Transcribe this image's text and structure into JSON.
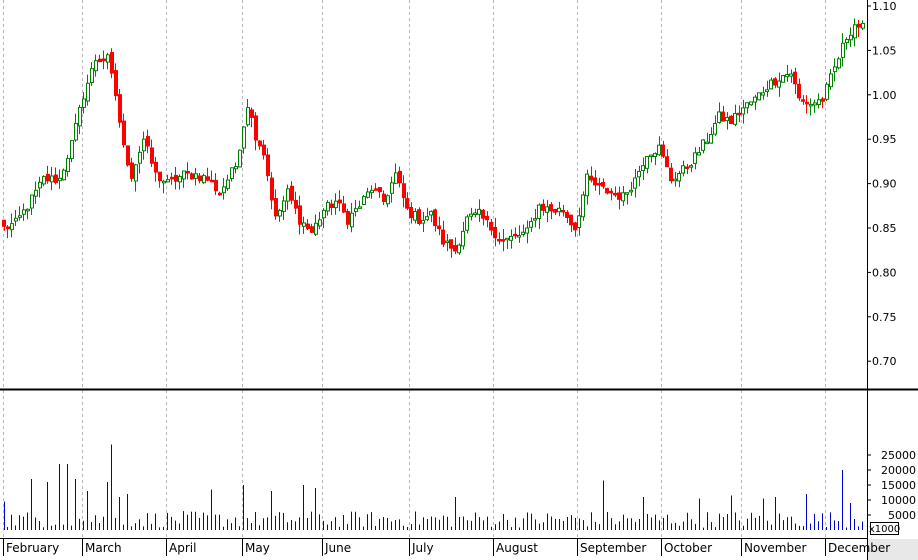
{
  "chart_data": [
    {
      "type": "candlestick",
      "panel": "price",
      "ylim": [
        0.66,
        1.1
      ],
      "y_ticks": [
        "1.10",
        "1.05",
        "1.00",
        "0.95",
        "0.90",
        "0.85",
        "0.80",
        "0.75",
        "0.70"
      ],
      "grid": "vertical-dashed-at-months",
      "colors": {
        "up": "#008000",
        "down": "#ff0000",
        "up_fill": "#ffffff",
        "down_fill": "#ff0000"
      },
      "anchors": [
        {
          "i": 0,
          "close": 0.85
        },
        {
          "i": 3,
          "close": 0.855
        },
        {
          "i": 6,
          "close": 0.875
        },
        {
          "i": 10,
          "close": 0.905
        },
        {
          "i": 14,
          "close": 0.905
        },
        {
          "i": 17,
          "close": 0.945
        },
        {
          "i": 20,
          "close": 1.0
        },
        {
          "i": 23,
          "close": 1.04
        },
        {
          "i": 26,
          "close": 1.04
        },
        {
          "i": 28,
          "close": 1.0
        },
        {
          "i": 30,
          "close": 0.94
        },
        {
          "i": 32,
          "close": 0.91
        },
        {
          "i": 35,
          "close": 0.95
        },
        {
          "i": 38,
          "close": 0.91
        },
        {
          "i": 41,
          "close": 0.9
        },
        {
          "i": 45,
          "close": 0.91
        },
        {
          "i": 48,
          "close": 0.91
        },
        {
          "i": 51,
          "close": 0.905
        },
        {
          "i": 54,
          "close": 0.89
        },
        {
          "i": 58,
          "close": 0.92
        },
        {
          "i": 61,
          "close": 0.99
        },
        {
          "i": 63,
          "close": 0.955
        },
        {
          "i": 65,
          "close": 0.935
        },
        {
          "i": 68,
          "close": 0.86
        },
        {
          "i": 71,
          "close": 0.89
        },
        {
          "i": 74,
          "close": 0.86
        },
        {
          "i": 77,
          "close": 0.845
        },
        {
          "i": 80,
          "close": 0.87
        },
        {
          "i": 83,
          "close": 0.88
        },
        {
          "i": 86,
          "close": 0.86
        },
        {
          "i": 89,
          "close": 0.875
        },
        {
          "i": 92,
          "close": 0.895
        },
        {
          "i": 95,
          "close": 0.88
        },
        {
          "i": 98,
          "close": 0.91
        },
        {
          "i": 101,
          "close": 0.87
        },
        {
          "i": 104,
          "close": 0.86
        },
        {
          "i": 107,
          "close": 0.865
        },
        {
          "i": 110,
          "close": 0.835
        },
        {
          "i": 113,
          "close": 0.825
        },
        {
          "i": 116,
          "close": 0.86
        },
        {
          "i": 119,
          "close": 0.865
        },
        {
          "i": 122,
          "close": 0.85
        },
        {
          "i": 125,
          "close": 0.835
        },
        {
          "i": 128,
          "close": 0.84
        },
        {
          "i": 131,
          "close": 0.845
        },
        {
          "i": 134,
          "close": 0.875
        },
        {
          "i": 137,
          "close": 0.87
        },
        {
          "i": 140,
          "close": 0.87
        },
        {
          "i": 143,
          "close": 0.85
        },
        {
          "i": 146,
          "close": 0.905
        },
        {
          "i": 149,
          "close": 0.895
        },
        {
          "i": 152,
          "close": 0.89
        },
        {
          "i": 155,
          "close": 0.885
        },
        {
          "i": 158,
          "close": 0.905
        },
        {
          "i": 161,
          "close": 0.935
        },
        {
          "i": 164,
          "close": 0.94
        },
        {
          "i": 167,
          "close": 0.905
        },
        {
          "i": 170,
          "close": 0.915
        },
        {
          "i": 173,
          "close": 0.93
        },
        {
          "i": 176,
          "close": 0.95
        },
        {
          "i": 179,
          "close": 0.975
        },
        {
          "i": 182,
          "close": 0.97
        },
        {
          "i": 185,
          "close": 0.985
        },
        {
          "i": 188,
          "close": 0.995
        },
        {
          "i": 191,
          "close": 1.01
        },
        {
          "i": 194,
          "close": 1.02
        },
        {
          "i": 197,
          "close": 1.025
        },
        {
          "i": 199,
          "close": 0.995
        },
        {
          "i": 202,
          "close": 0.99
        },
        {
          "i": 205,
          "close": 0.995
        },
        {
          "i": 208,
          "close": 1.03
        },
        {
          "i": 211,
          "close": 1.065
        },
        {
          "i": 213,
          "close": 1.08
        },
        {
          "i": 215,
          "close": 1.075
        }
      ]
    },
    {
      "type": "bar",
      "panel": "volume",
      "ylim": [
        0,
        30000
      ],
      "y_ticks": [
        "25000",
        "20000",
        "15000",
        "10000",
        "5000"
      ],
      "multiplier_label": "x1000",
      "color": "#0000cc",
      "spikes": [
        {
          "i": 0,
          "v": 9500
        },
        {
          "i": 7,
          "v": 17000
        },
        {
          "i": 11,
          "v": 16000
        },
        {
          "i": 14,
          "v": 22000
        },
        {
          "i": 16,
          "v": 22000
        },
        {
          "i": 18,
          "v": 17000
        },
        {
          "i": 21,
          "v": 13000
        },
        {
          "i": 26,
          "v": 16000
        },
        {
          "i": 27,
          "v": 28500
        },
        {
          "i": 29,
          "v": 11000
        },
        {
          "i": 31,
          "v": 12000
        },
        {
          "i": 52,
          "v": 13500
        },
        {
          "i": 60,
          "v": 15000
        },
        {
          "i": 67,
          "v": 13000
        },
        {
          "i": 75,
          "v": 15000
        },
        {
          "i": 78,
          "v": 14000
        },
        {
          "i": 113,
          "v": 11000
        },
        {
          "i": 150,
          "v": 16500
        },
        {
          "i": 160,
          "v": 11000
        },
        {
          "i": 174,
          "v": 10500
        },
        {
          "i": 182,
          "v": 11500
        },
        {
          "i": 190,
          "v": 10500
        },
        {
          "i": 193,
          "v": 11000
        },
        {
          "i": 201,
          "v": 12000
        },
        {
          "i": 210,
          "v": 20000
        },
        {
          "i": 212,
          "v": 9000
        }
      ]
    }
  ],
  "time_axis": {
    "bars": 216,
    "months": [
      {
        "name": "February",
        "start": 0
      },
      {
        "name": "March",
        "start": 20
      },
      {
        "name": "April",
        "start": 41
      },
      {
        "name": "May",
        "start": 60
      },
      {
        "name": "June",
        "start": 80
      },
      {
        "name": "July",
        "start": 102
      },
      {
        "name": "August",
        "start": 123
      },
      {
        "name": "September",
        "start": 144
      },
      {
        "name": "October",
        "start": 165
      },
      {
        "name": "November",
        "start": 185
      },
      {
        "name": "December",
        "start": 206
      }
    ]
  }
}
